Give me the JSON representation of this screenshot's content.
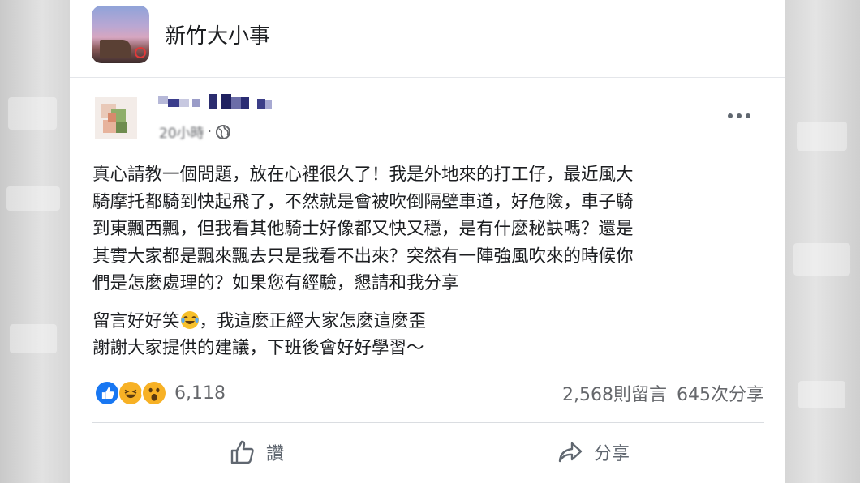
{
  "group": {
    "name": "新竹大小事",
    "avatar_icon": "group-cover-photo"
  },
  "post": {
    "author_redacted": true,
    "time": "20小時",
    "separator": "·",
    "privacy_icon": "globe-icon",
    "more_icon": "more-dots-icon",
    "body_lines": [
      "真心請教一個問題，放在心裡很久了！我是外地來的打工仔，最近風大",
      "騎摩托都騎到快起飛了，不然就是會被吹倒隔壁車道，好危險，車子騎",
      "到東飄西飄，但我看其他騎士好像都又快又穩，是有什麼秘訣嗎？還是",
      "其實大家都是飄來飄去只是我看不出來？突然有一陣強風吹來的時候你",
      "們是怎麼處理的？如果您有經驗，懇請和我分享"
    ],
    "edit_line1_before": "留言好好笑",
    "edit_line1_emoji": "laughing-tears-emoji",
    "edit_line1_after": "，我這麼正經大家怎麼這麼歪",
    "edit_line2": "謝謝大家提供的建議，下班後會好好學習～"
  },
  "stats": {
    "reactions": [
      "like",
      "haha",
      "wow"
    ],
    "reaction_count": "6,118",
    "comments": "2,568則留言",
    "shares": "645次分享"
  },
  "actions": {
    "like_label": "讚",
    "share_label": "分享"
  },
  "colors": {
    "like_blue": "#1877f2",
    "emoji_yellow": "#f7b125",
    "text_gray": "#65676b"
  }
}
